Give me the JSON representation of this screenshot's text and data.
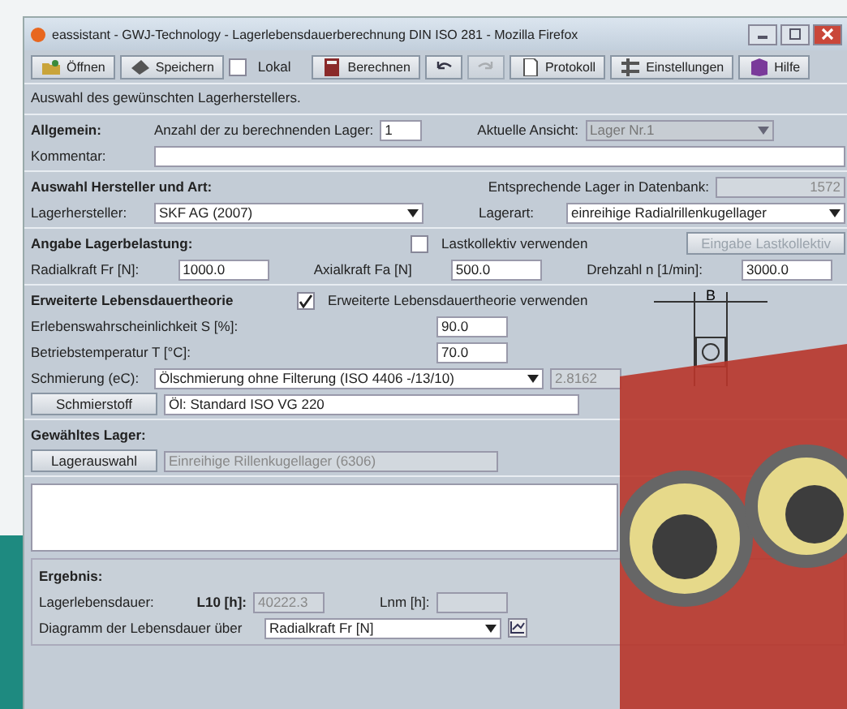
{
  "window": {
    "title": "eassistant - GWJ-Technology - Lagerlebensdauerberechnung DIN ISO 281 - Mozilla Firefox"
  },
  "toolbar": [
    {
      "kind": "button",
      "label": "Öffnen"
    },
    {
      "kind": "button",
      "label": "Speichern"
    },
    {
      "kind": "checkbox",
      "label": "Lokal",
      "checked": false
    },
    {
      "kind": "button",
      "label": "Berechnen"
    },
    {
      "kind": "undo",
      "disabled": false
    },
    {
      "kind": "redo",
      "disabled": true
    },
    {
      "kind": "button",
      "label": "Protokoll"
    },
    {
      "kind": "button",
      "label": "Einstellungen"
    },
    {
      "kind": "button",
      "label": "Hilfe"
    }
  ],
  "hint": "Auswahl des gewünschten Lagerherstellers.",
  "general": {
    "heading": "Allgemein:",
    "count_label": "Anzahl der zu berechnenden Lager:",
    "count": "1",
    "view_label": "Aktuelle Ansicht:",
    "view": "Lager Nr.1",
    "view_disabled": true,
    "comment_label": "Kommentar:"
  },
  "selection": {
    "heading": "Auswahl Hersteller und Art:",
    "db_label": "Entsprechende Lager in Datenbank:",
    "db_count": "1572",
    "maker_label": "Lagerhersteller:",
    "maker": "SKF AG (2007)",
    "type_label": "Lagerart:",
    "type": "einreihige Radialrillenkugellager"
  },
  "load": {
    "heading": "Angabe Lagerbelastung:",
    "collective_label": "Lastkollektiv verwenden",
    "collective_checked": false,
    "collective_button": "Eingabe Lastkollektiv",
    "collective_button_disabled": true,
    "fields": [
      {
        "label": "Radialkraft Fr [N]:",
        "value": "1000.0"
      },
      {
        "label": "Axialkraft Fa [N]",
        "value": "500.0"
      },
      {
        "label": "Drehzahl n [1/min]:",
        "value": "3000.0"
      }
    ]
  },
  "extended": {
    "heading": "Erweiterte Lebensdauertheorie",
    "use_label": "Erweiterte Lebensdauertheorie verwenden",
    "use_checked": true,
    "probability_label": "Erlebenswahrscheinlichkeit S [%]:",
    "probability": "90.0",
    "temp_label": "Betriebstemperatur T [°C]:",
    "temp": "70.0",
    "lube_label": "Schmierung (eC):",
    "lube": "Ölschmierung ohne Filterung (ISO 4406 -/13/10)",
    "ec": "2.8162",
    "lubricant_button": "Schmierstoff",
    "lubricant": "Öl: Standard ISO VG 220",
    "diagram_label": "B"
  },
  "chosen": {
    "heading": "Gewähltes Lager:",
    "button": "Lagerauswahl",
    "bearing": "Einreihige Rillenkugellager (6306)"
  },
  "result": {
    "heading": "Ergebnis:",
    "life_label": "Lagerlebensdauer:",
    "l10_label": "L10 [h]:",
    "l10": "40222.3",
    "lnm_label": "Lnm [h]:",
    "chart_label": "Diagramm der Lebensdauer über",
    "chart_axis": "Radialkraft Fr [N]"
  }
}
